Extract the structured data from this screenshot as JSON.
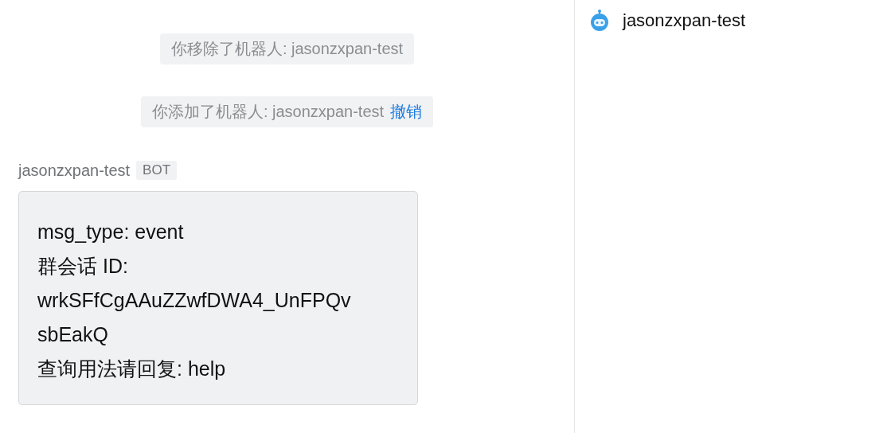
{
  "chat": {
    "notices": [
      {
        "text": "你移除了机器人: jasonzxpan-test"
      },
      {
        "text": "你添加了机器人: jasonzxpan-test",
        "action": "撤销"
      }
    ],
    "message": {
      "sender": "jasonzxpan-test",
      "badge": "BOT",
      "lines": [
        "msg_type: event",
        "群会话 ID:",
        "wrkSFfCgAAuZZwfDWA4_UnFPQv",
        "sbEakQ",
        "查询用法请回复: help"
      ]
    }
  },
  "sidebar": {
    "items": [
      {
        "name": "jasonzxpan-test"
      }
    ]
  }
}
